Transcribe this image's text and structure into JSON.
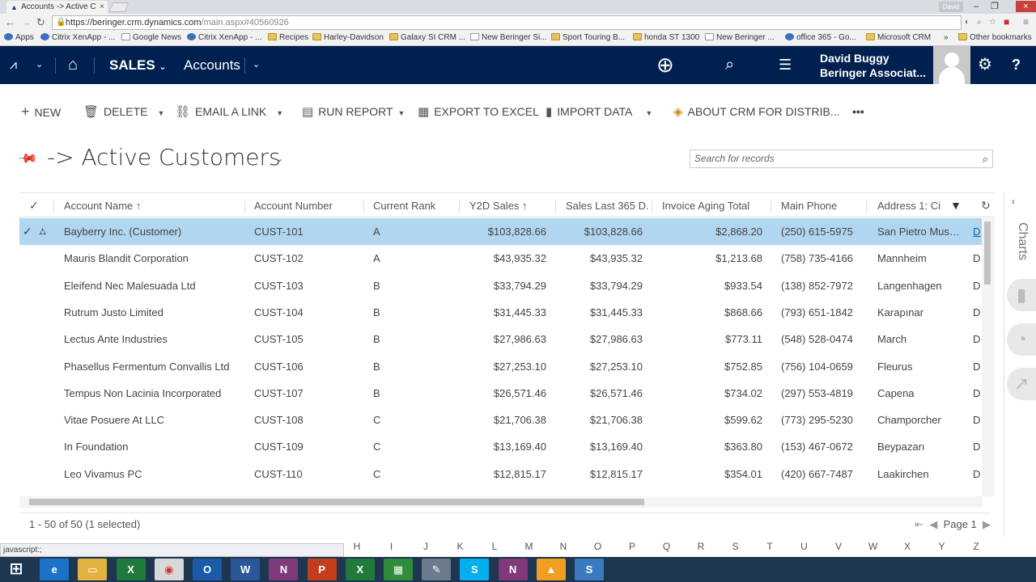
{
  "browser": {
    "tab_title": "Accounts -> Active C",
    "url_host": "https://beringer.crm.dynamics.com",
    "url_path": "/main.aspx#40560926",
    "window_user": "David",
    "bookmarks": [
      "Apps",
      "Citrix XenApp - ...",
      "Google News",
      "Citrix XenApp - ...",
      "Recipes",
      "Harley-Davidson",
      "Galaxy SI CRM ...",
      "New Beringer Si...",
      "Sport Touring B...",
      "honda ST 1300",
      "New Beringer ...",
      "office 365 - Go...",
      "Microsoft CRM",
      "»",
      "Other bookmarks"
    ],
    "status_text": "javascript:;"
  },
  "nav": {
    "module": "SALES",
    "entity": "Accounts",
    "user_name": "David Buggy",
    "user_org": "Beringer Associat..."
  },
  "commands": {
    "new": "NEW",
    "delete": "DELETE",
    "email_link": "EMAIL A LINK",
    "run_report": "RUN REPORT",
    "export": "EXPORT TO EXCEL",
    "import": "IMPORT DATA",
    "about": "ABOUT CRM FOR DISTRIB...",
    "more": "•••"
  },
  "view": {
    "title": "-> Active Customers",
    "search_placeholder": "Search for records"
  },
  "grid": {
    "columns": [
      "Account Name",
      "Account Number",
      "Current Rank",
      "Y2D Sales",
      "Sales Last 365 D...",
      "Invoice Aging Total",
      "Main Phone",
      "Address 1: Ci"
    ],
    "rows": [
      [
        "Bayberry Inc. (Customer)",
        "CUST-101",
        "A",
        "$103,828.66",
        "$103,828.66",
        "$2,868.20",
        "(250) 615-5975",
        "San Pietro Muss...",
        "D"
      ],
      [
        "Mauris Blandit Corporation",
        "CUST-102",
        "A",
        "$43,935.32",
        "$43,935.32",
        "$1,213.68",
        "(758) 735-4166",
        "Mannheim",
        "D"
      ],
      [
        "Eleifend Nec Malesuada Ltd",
        "CUST-103",
        "B",
        "$33,794.29",
        "$33,794.29",
        "$933.54",
        "(138) 852-7972",
        "Langenhagen",
        "D"
      ],
      [
        "Rutrum Justo Limited",
        "CUST-104",
        "B",
        "$31,445.33",
        "$31,445.33",
        "$868.66",
        "(793) 651-1842",
        "Karapınar",
        "D"
      ],
      [
        "Lectus Ante Industries",
        "CUST-105",
        "B",
        "$27,986.63",
        "$27,986.63",
        "$773.11",
        "(548) 528-0474",
        "March",
        "D"
      ],
      [
        "Phasellus Fermentum Convallis Ltd",
        "CUST-106",
        "B",
        "$27,253.10",
        "$27,253.10",
        "$752.85",
        "(756) 104-0659",
        "Fleurus",
        "D"
      ],
      [
        "Tempus Non Lacinia Incorporated",
        "CUST-107",
        "B",
        "$26,571.46",
        "$26,571.46",
        "$734.02",
        "(297) 553-4819",
        "Capena",
        "D"
      ],
      [
        "Vitae Posuere At LLC",
        "CUST-108",
        "C",
        "$21,706.38",
        "$21,706.38",
        "$599.62",
        "(773) 295-5230",
        "Champorcher",
        "D"
      ],
      [
        "In Foundation",
        "CUST-109",
        "C",
        "$13,169.40",
        "$13,169.40",
        "$363.80",
        "(153) 467-0672",
        "Beypazarı",
        "D"
      ],
      [
        "Leo Vivamus PC",
        "CUST-110",
        "C",
        "$12,815.17",
        "$12,815.17",
        "$354.01",
        "(420) 667-7487",
        "Laakirchen",
        "D"
      ]
    ],
    "status": "1 - 50 of 50 (1 selected)",
    "page_label": "Page 1"
  },
  "alphabet": [
    "H",
    "I",
    "J",
    "K",
    "L",
    "M",
    "N",
    "O",
    "P",
    "Q",
    "R",
    "S",
    "T",
    "U",
    "V",
    "W",
    "X",
    "Y",
    "Z"
  ],
  "side_pane": {
    "label": "Charts"
  },
  "taskbar": [
    "start",
    "ie",
    "explorer",
    "excel-green",
    "chrome",
    "outlook",
    "word",
    "onenote",
    "powerpoint",
    "excel",
    "calculator",
    "paint",
    "skype",
    "onenote-2",
    "vlc",
    "snagit"
  ],
  "colors": {
    "nav_bg": "#002050",
    "selected_row": "#b1d6f0",
    "taskbar": "#1e3650"
  }
}
